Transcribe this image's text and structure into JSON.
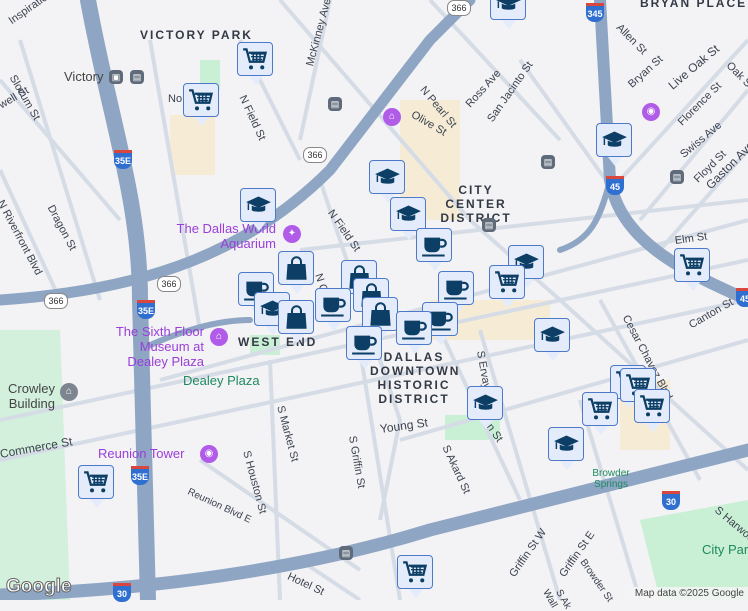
{
  "districts": {
    "victory_park": "VICTORY PARK",
    "bryan_place": "BRYAN PLACE",
    "city_center": "CITY CENTER DISTRICT",
    "west_end": "WEST END",
    "historic": "DALLAS DOWNTOWN HISTORIC DISTRICT"
  },
  "pois": {
    "aquarium": "The Dallas World Aquarium",
    "sixth_floor": "The Sixth Floor Museum at Dealey Plaza",
    "reunion": "Reunion Tower",
    "crowley": "Crowley Building",
    "dealey": "Dealey Plaza",
    "browder": "Browder Springs",
    "city_park": "City Park",
    "victory": "Victory"
  },
  "streets": [
    "Inspiration",
    "Slocum St",
    "N Riverfront Blvd",
    "Dragon St",
    "well St",
    "N Field St",
    "McKinney Ave",
    "N Pearl St",
    "Ross Ave",
    "San Jacinto St",
    "Olive St",
    "Allen St",
    "Bryan St",
    "Live Oak St",
    "Oak St",
    "Florence St",
    "Swiss Ave",
    "Floyd St",
    "Gaston Ave",
    "Elm St",
    "Canton St",
    "Cesar Chavez Blvd",
    "S Ervay St",
    "Young St",
    "S Akard St",
    "S Griffin St",
    "S Houston St",
    "S Market St",
    "Commerce St",
    "Reunion Blvd E",
    "Hotel St",
    "Griffin St W",
    "Griffin St E",
    "Browder St",
    "S Harwood",
    "N Griffin St",
    "No",
    "Wall",
    "S Ak"
  ],
  "shields": {
    "sh366": "366",
    "i35e": "35E",
    "i345": "345",
    "i45": "45",
    "i30": "30"
  },
  "markers": {
    "cart": "shopping-cart",
    "grad": "school",
    "coffee": "cafe",
    "bag": "shopping-bag"
  },
  "footer": {
    "logo": "Google",
    "attribution": "Map data ©2025 Google"
  },
  "colors": {
    "highway": "#8ea5c4",
    "street": "#d5dce6",
    "marker_bg": "#e4ecfb",
    "marker_icon": "#0d3f66",
    "poi": "#9a3fd9"
  }
}
